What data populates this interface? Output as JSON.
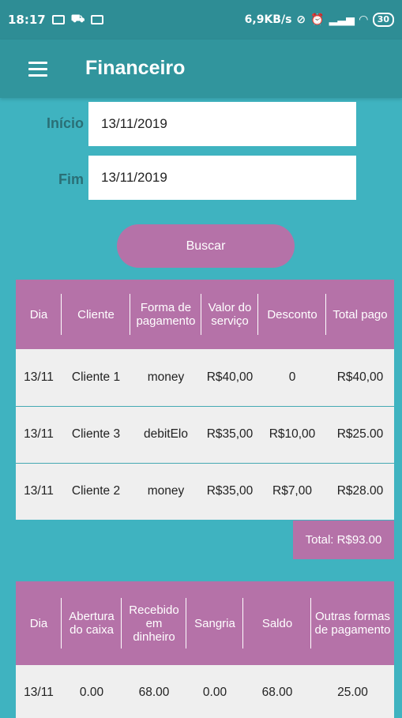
{
  "status_bar": {
    "time": "18:17",
    "net_speed": "6,9KB/s",
    "battery": "30"
  },
  "app_bar": {
    "title": "Financeiro",
    "menu_icon": "hamburger-menu-icon"
  },
  "filters": {
    "start_label": "Início",
    "start_value": "13/11/2019",
    "end_label": "Fim",
    "end_value": "13/11/2019"
  },
  "search_button": "Buscar",
  "payments_table": {
    "headers": [
      "Dia",
      "Cliente",
      "Forma de pagamento",
      "Valor do serviço",
      "Desconto",
      "Total pago"
    ],
    "rows": [
      [
        "13/11",
        "Cliente 1",
        "money",
        "R$40,00",
        "0",
        "R$40,00"
      ],
      [
        "13/11",
        "Cliente 3",
        "debitElo",
        "R$35,00",
        "R$10,00",
        "R$25.00"
      ],
      [
        "13/11",
        "Cliente 2",
        "money",
        "R$35,00",
        "R$7,00",
        "R$28.00"
      ]
    ],
    "total": "Total: R$93.00"
  },
  "cash_table": {
    "headers": [
      "Dia",
      "Abertura do caixa",
      "Recebido em dinheiro",
      "Sangria",
      "Saldo",
      "Outras formas de pagamento"
    ],
    "rows": [
      [
        "13/11",
        "0.00",
        "68.00",
        "0.00",
        "68.00",
        "25.00"
      ]
    ]
  },
  "colors": {
    "background": "#3fb3c0",
    "app_bar": "#31959d",
    "accent": "#b572a8"
  }
}
